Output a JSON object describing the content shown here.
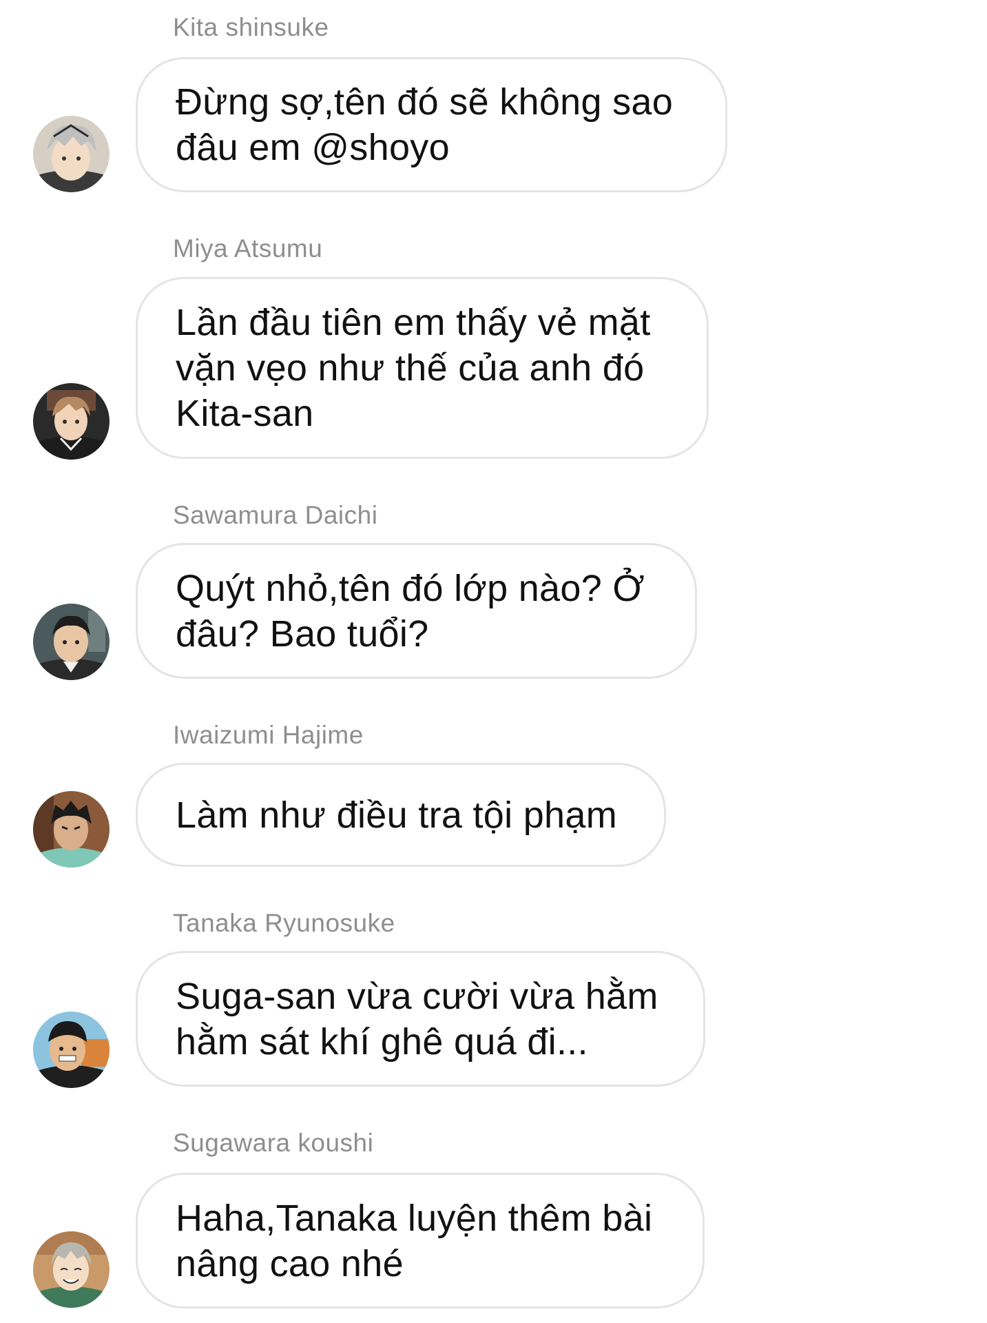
{
  "messages": [
    {
      "sender": "Kita shinsuke",
      "text": "Đừng sợ,tên đó sẽ không sao đâu em @shoyo",
      "avatar": "kita-avatar"
    },
    {
      "sender": "Miya Atsumu",
      "text": "Lần đầu tiên em thấy vẻ mặt vặn vẹo như thế của anh đó Kita-san",
      "avatar": "atsumu-avatar"
    },
    {
      "sender": "Sawamura Daichi",
      "text": "Quýt nhỏ,tên đó lớp nào? Ở đâu? Bao tuổi?",
      "avatar": "daichi-avatar"
    },
    {
      "sender": "Iwaizumi Hajime",
      "text": "Làm như điều tra tội phạm",
      "avatar": "iwaizumi-avatar"
    },
    {
      "sender": "Tanaka Ryunosuke",
      "text": "Suga-san vừa cười vừa hằm hằm sát khí ghê quá đi...",
      "avatar": "tanaka-avatar"
    },
    {
      "sender": "Sugawara koushi",
      "text": "Haha,Tanaka luyện thêm bài nâng cao nhé",
      "avatar": "sugawara-avatar"
    }
  ]
}
